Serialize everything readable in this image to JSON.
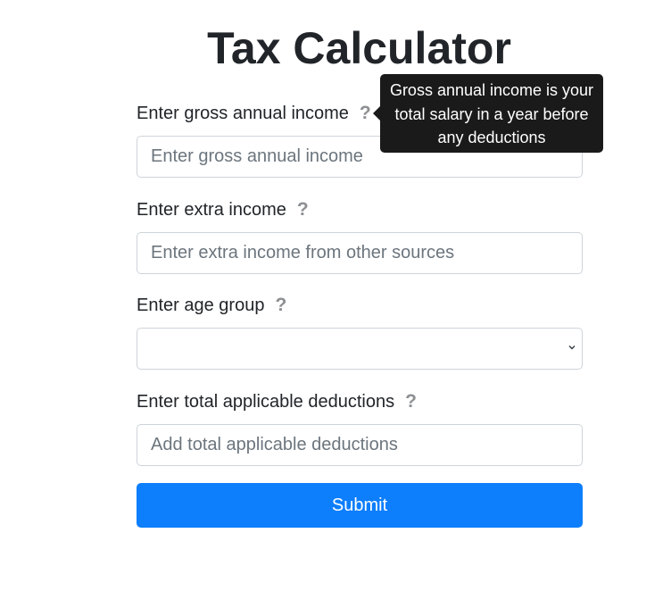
{
  "page": {
    "title": "Tax Calculator"
  },
  "form": {
    "gross_income": {
      "label": "Enter gross annual income",
      "help_icon": "question-mark-icon",
      "placeholder": "Enter gross annual income",
      "value": ""
    },
    "extra_income": {
      "label": "Enter extra income",
      "help_icon": "question-mark-icon",
      "placeholder": "Enter extra income from other sources",
      "value": ""
    },
    "age_group": {
      "label": "Enter age group",
      "help_icon": "question-mark-icon",
      "selected": ""
    },
    "deductions": {
      "label": "Enter total applicable deductions",
      "help_icon": "question-mark-icon",
      "placeholder": "Add total applicable deductions",
      "value": ""
    },
    "submit_label": "Submit"
  },
  "tooltip": {
    "text": "Gross annual income is your total salary in a year before any deductions"
  },
  "colors": {
    "primary": "#0d7efc",
    "tooltip_bg": "#1a1a1a",
    "help_icon": "#8d8f92",
    "border": "#ced4da"
  }
}
